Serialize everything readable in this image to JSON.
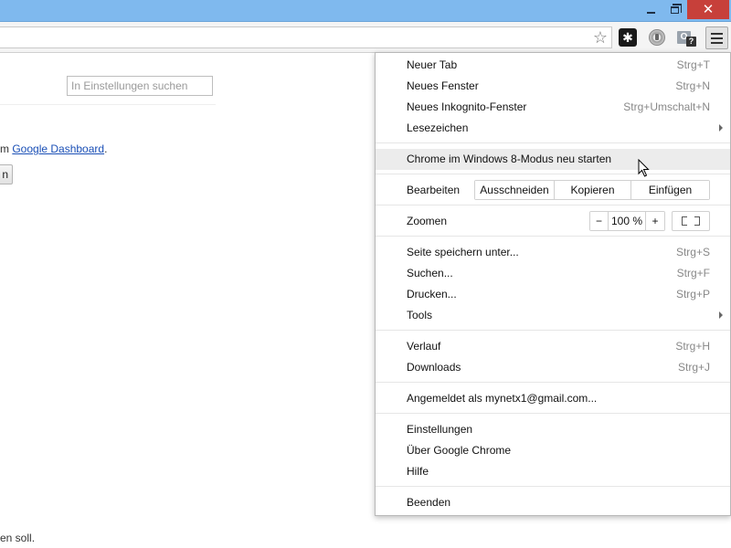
{
  "window": {
    "minimize_glyph": "",
    "close_glyph": "✕",
    "accent_color": "#7fb9ee",
    "close_color": "#c7403a"
  },
  "toolbar": {
    "star_glyph": "☆",
    "extensions": [
      {
        "name": "puzzle-extension-icon",
        "glyph": "✱"
      },
      {
        "name": "shield-extension-icon",
        "glyph": ""
      },
      {
        "name": "outlook-extension-icon",
        "glyph": "O",
        "badge": "?"
      }
    ]
  },
  "page": {
    "search_placeholder": "In Einstellungen suchen",
    "dashboard_prefix": "m ",
    "dashboard_link": "Google Dashboard",
    "dashboard_suffix": ".",
    "cut_button_label": "n",
    "footer_text": "en soll."
  },
  "menu": {
    "new_tab": {
      "label": "Neuer Tab",
      "shortcut": "Strg+T"
    },
    "new_window": {
      "label": "Neues Fenster",
      "shortcut": "Strg+N"
    },
    "incognito": {
      "label": "Neues Inkognito-Fenster",
      "shortcut": "Strg+Umschalt+N"
    },
    "bookmarks": {
      "label": "Lesezeichen"
    },
    "restart_win8": {
      "label": "Chrome im Windows 8-Modus neu starten"
    },
    "edit": {
      "label": "Bearbeiten",
      "cut": "Ausschneiden",
      "copy": "Kopieren",
      "paste": "Einfügen"
    },
    "zoom": {
      "label": "Zoomen",
      "minus": "−",
      "value": "100 %",
      "plus": "+"
    },
    "save_page": {
      "label": "Seite speichern unter...",
      "shortcut": "Strg+S"
    },
    "find": {
      "label": "Suchen...",
      "shortcut": "Strg+F"
    },
    "print": {
      "label": "Drucken...",
      "shortcut": "Strg+P"
    },
    "tools": {
      "label": "Tools"
    },
    "history": {
      "label": "Verlauf",
      "shortcut": "Strg+H"
    },
    "downloads": {
      "label": "Downloads",
      "shortcut": "Strg+J"
    },
    "signed_in": {
      "label": "Angemeldet als mynetx1@gmail.com..."
    },
    "settings": {
      "label": "Einstellungen"
    },
    "about": {
      "label": "Über Google Chrome"
    },
    "help": {
      "label": "Hilfe"
    },
    "exit": {
      "label": "Beenden"
    }
  }
}
